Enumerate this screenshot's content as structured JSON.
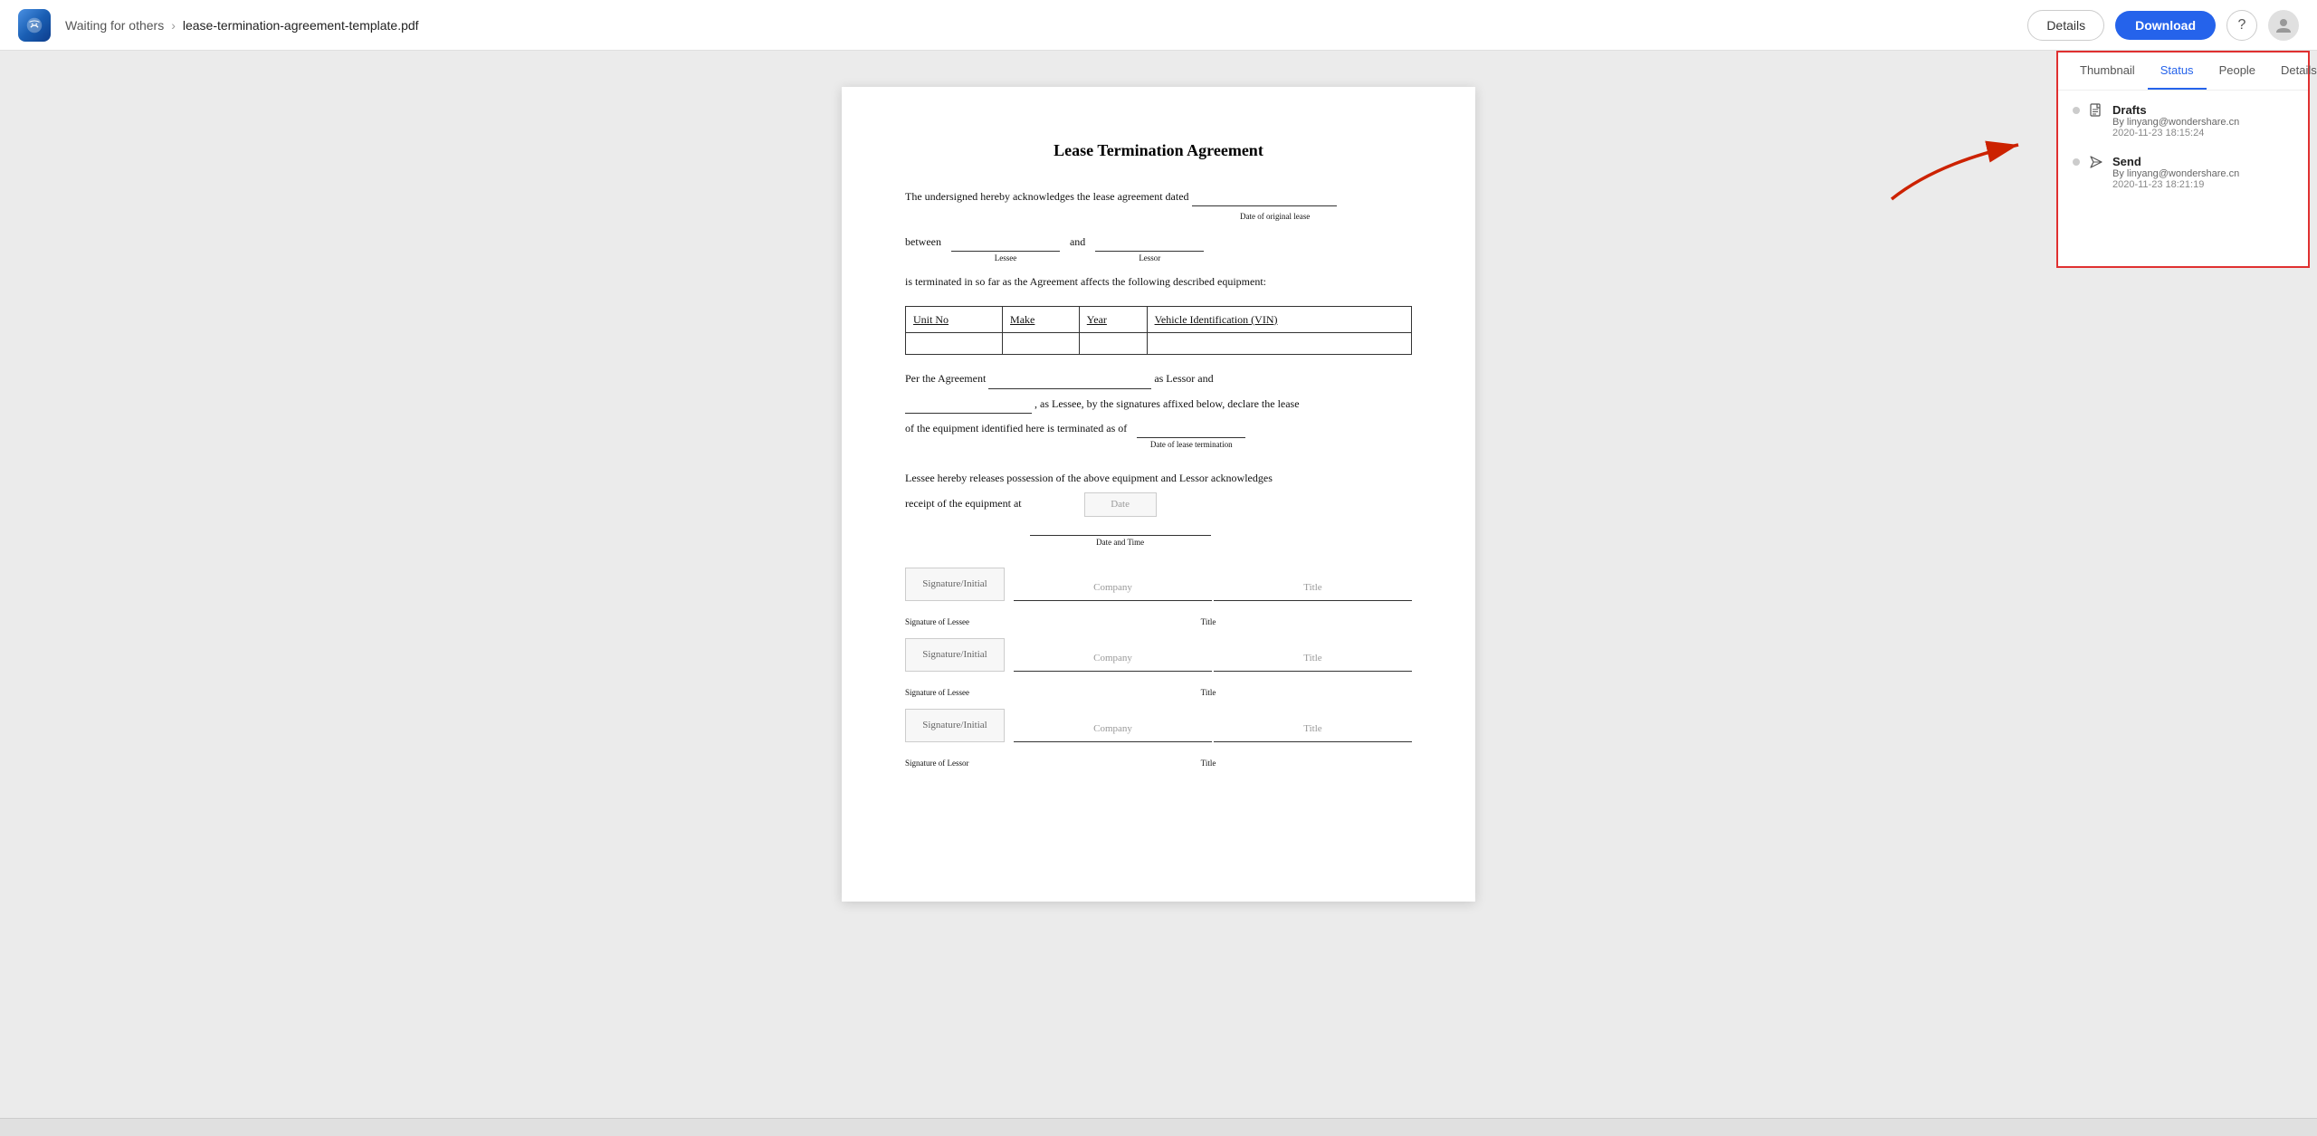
{
  "topbar": {
    "breadcrumb_parent": "Waiting for others",
    "breadcrumb_separator": "›",
    "breadcrumb_current": "lease-termination-agreement-template.pdf",
    "btn_details_label": "Details",
    "btn_download_label": "Download"
  },
  "panel": {
    "tabs": [
      {
        "id": "thumbnail",
        "label": "Thumbnail"
      },
      {
        "id": "status",
        "label": "Status",
        "active": true
      },
      {
        "id": "people",
        "label": "People"
      },
      {
        "id": "details",
        "label": "Details"
      }
    ],
    "status_items": [
      {
        "id": "drafts",
        "icon_type": "file",
        "name": "Drafts",
        "email": "By linyang@wondershare.cn",
        "time": "2020-11-23 18:15:24"
      },
      {
        "id": "send",
        "icon_type": "send",
        "name": "Send",
        "email": "By linyang@wondershare.cn",
        "time": "2020-11-23 18:21:19"
      }
    ]
  },
  "pdf": {
    "title": "Lease Termination Agreement",
    "para1": "The undersigned hereby acknowledges the lease agreement dated",
    "label_date_original": "Date of original lease",
    "para1b": "between",
    "label_lessee": "Lessee",
    "para1c": "and",
    "label_lessor": "Lessor",
    "para2": "is terminated in so far as the Agreement affects the following described equipment:",
    "table_headers": [
      "Unit No",
      "Make",
      "Year",
      "Vehicle Identification (VIN)"
    ],
    "para3": "Per the Agreement",
    "para3b": "as Lessor and",
    "para4": ", as Lessee, by the signatures affixed below, declare the lease",
    "para5": "of the equipment identified here is terminated as of",
    "label_date_termination": "Date of lease termination",
    "para6": "Lessee hereby releases possession of the above equipment and Lessor acknowledges",
    "para7": "receipt of the equipment at",
    "date_placeholder": "Date",
    "label_date_time": "Date and Time",
    "sig_rows": [
      {
        "sig_label": "Signature/Initial",
        "company_placeholder": "Company",
        "title_placeholder": "Title",
        "bottom_label": "Signature of Lessee",
        "title_label": "Title"
      },
      {
        "sig_label": "Signature/Initial",
        "company_placeholder": "Company",
        "title_placeholder": "Title",
        "bottom_label": "Signature of Lessee",
        "title_label": "Title"
      },
      {
        "sig_label": "Signature/Initial",
        "company_placeholder": "Company",
        "title_placeholder": "Title",
        "bottom_label": "Signature of Lessor",
        "title_label": "Title"
      }
    ]
  }
}
